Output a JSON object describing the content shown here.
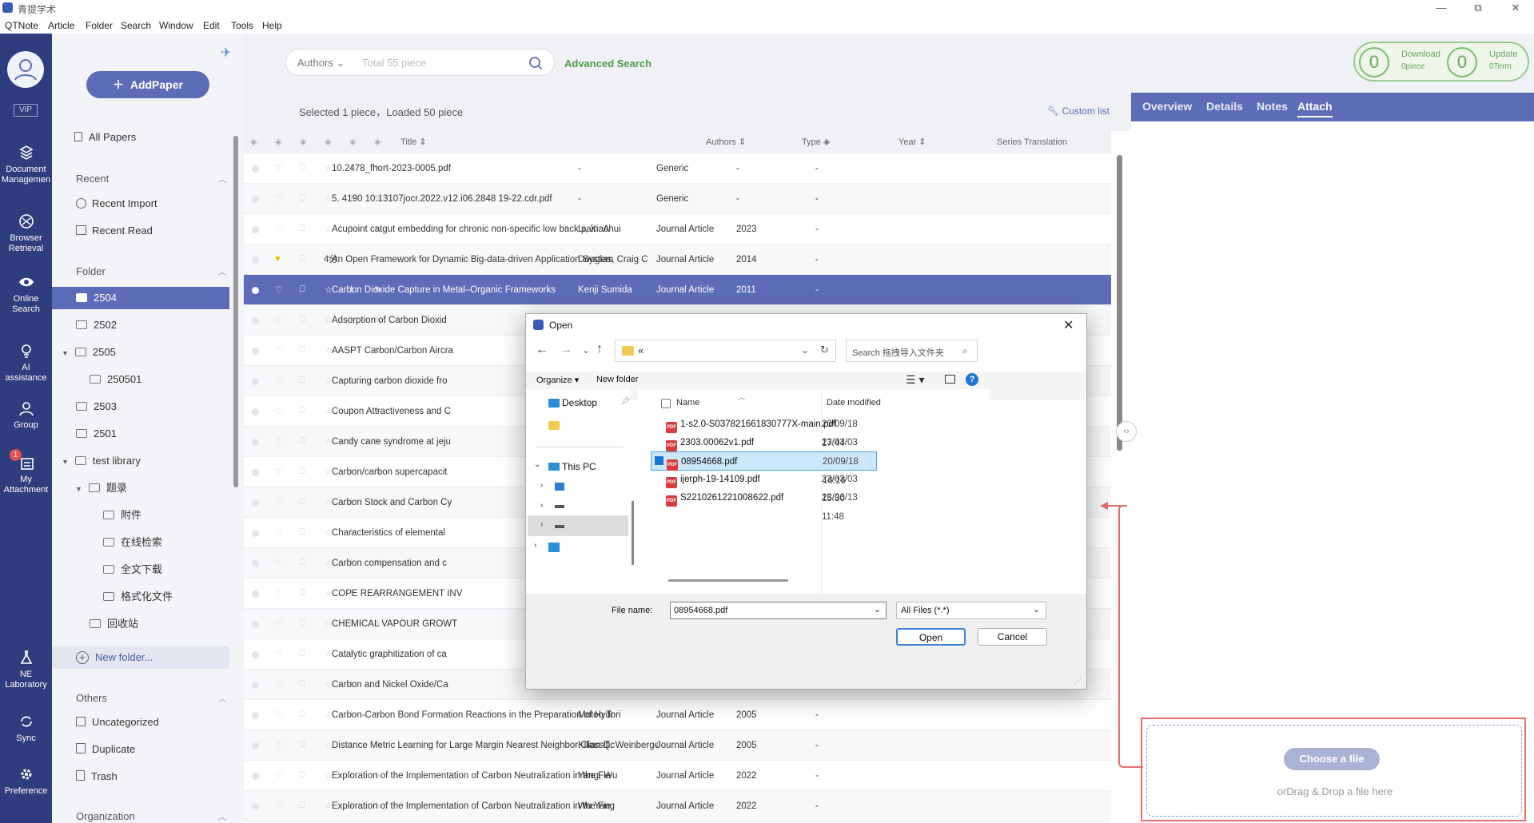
{
  "app": {
    "title": "青提学术"
  },
  "menu": [
    "QTNote",
    "Article",
    "Folder",
    "Search",
    "Window",
    "Edit",
    "Tools",
    "Help"
  ],
  "window_controls": [
    "—",
    "▢",
    "⧉",
    "✕"
  ],
  "leftnav": {
    "vip": "VIP",
    "items": [
      {
        "label": "Document Managemen",
        "icon": "document-icon"
      },
      {
        "label": "Browser Retrieval",
        "icon": "browser-icon"
      },
      {
        "label": "Online Search",
        "icon": "eye-icon"
      },
      {
        "label": "AI assistance",
        "icon": "ai-icon"
      },
      {
        "label": "Group",
        "icon": "group-icon"
      },
      {
        "label": "My Attachment",
        "icon": "attachment-icon",
        "badge": "1"
      },
      {
        "label": "NE Laboratory",
        "icon": "laboratory-icon"
      },
      {
        "label": "Sync",
        "icon": "sync-icon"
      },
      {
        "label": "Preference",
        "icon": "gear-icon"
      }
    ]
  },
  "folderpanel": {
    "add_paper": "AddPaper",
    "all_papers": "All Papers",
    "recent_title": "Recent",
    "recent_import": "Recent Import",
    "recent_read": "Recent Read",
    "folder_title": "Folder",
    "folders": [
      "2504",
      "2502",
      "2505",
      "250501",
      "2503",
      "2501",
      "test library",
      "题录",
      "附件",
      "在线检索",
      "全文下载",
      "格式化文件",
      "回收站"
    ],
    "new_folder": "New folder...",
    "others_title": "Others",
    "uncategorized": "Uncategorized",
    "duplicate": "Duplicate",
    "trash": "Trash",
    "organization_title": "Organization"
  },
  "search": {
    "field": "Authors",
    "placeholder": "Total 55 piece",
    "advanced": "Advanced Search"
  },
  "stats": {
    "download_count": "0",
    "download_label": "Download",
    "download_sub": "0piece",
    "update_count": "0",
    "update_label": "Update",
    "update_sub": "0Term"
  },
  "list": {
    "status": "Selected 1 piece，Loaded 50 piece",
    "custom_list": "Custom list",
    "columns": {
      "title": "Title",
      "authors": "Authors",
      "type": "Type",
      "year": "Year",
      "series": "Series Translation"
    },
    "rows": [
      {
        "title": "10.2478_fhort-2023-0005.pdf",
        "authors": "-",
        "type": "Generic",
        "year": "-",
        "series": "-"
      },
      {
        "title": "5. 4190 10.13107jocr.2022.v12.i06.2848 19-22.cdr.pdf",
        "authors": "-",
        "type": "Generic",
        "year": "-",
        "series": "-"
      },
      {
        "title": "Acupoint catgut embedding for chronic non-specific low back pain: A",
        "authors": "Li, Xiaohui",
        "type": "Journal Article",
        "year": "2023",
        "series": "-"
      },
      {
        "title": "An Open Framework for Dynamic Big-data-driven Application System",
        "authors": "Douglas, Craig C",
        "type": "Journal Article",
        "year": "2014",
        "series": "-",
        "rating": "4分"
      },
      {
        "title": "Carbon Dioxide Capture in Metal–Organic Frameworks",
        "authors": "Kenji Sumida",
        "type": "Journal Article",
        "year": "2011",
        "series": "-"
      },
      {
        "title": "Adsorption of Carbon Dioxid",
        "authors": "",
        "type": "",
        "year": "",
        "series": ""
      },
      {
        "title": "AASPT Carbon/Carbon Aircra",
        "authors": "",
        "type": "",
        "year": "",
        "series": ""
      },
      {
        "title": "Capturing carbon dioxide fro",
        "authors": "",
        "type": "",
        "year": "",
        "series": ""
      },
      {
        "title": "Coupon Attractiveness and C",
        "authors": "",
        "type": "",
        "year": "",
        "series": ""
      },
      {
        "title": "Candy cane syndrome at jeju",
        "authors": "",
        "type": "",
        "year": "",
        "series": ""
      },
      {
        "title": "Carbon/carbon supercapacit",
        "authors": "",
        "type": "",
        "year": "",
        "series": ""
      },
      {
        "title": "Carbon Stock and Carbon Cy",
        "authors": "",
        "type": "",
        "year": "",
        "series": ""
      },
      {
        "title": "Characteristics of elemental",
        "authors": "",
        "type": "",
        "year": "",
        "series": ""
      },
      {
        "title": "Carbon compensation and c",
        "authors": "",
        "type": "",
        "year": "",
        "series": ""
      },
      {
        "title": "COPE REARRANGEMENT INV",
        "authors": "",
        "type": "",
        "year": "",
        "series": ""
      },
      {
        "title": "CHEMICAL VAPOUR GROWT",
        "authors": "",
        "type": "",
        "year": "",
        "series": ""
      },
      {
        "title": "Catalytic graphitization of ca",
        "authors": "",
        "type": "",
        "year": "",
        "series": ""
      },
      {
        "title": "Carbon and Nickel Oxide/Ca",
        "authors": "",
        "type": "",
        "year": "",
        "series": ""
      },
      {
        "title": "Carbon-Carbon Bond Formation Reactions in the Preparation of Hydr",
        "authors": "Motoo Tori",
        "type": "Journal Article",
        "year": "2005",
        "series": "-"
      },
      {
        "title": "Distance Metric Learning for Large Margin Nearest Neighbor Classific",
        "authors": "Kilian Q. Weinberger",
        "type": "Journal Article",
        "year": "2005",
        "series": "-"
      },
      {
        "title": "Exploration of the Implementation of Carbon Neutralization in the Fie",
        "authors": "Yang, Wu",
        "type": "Journal Article",
        "year": "2022",
        "series": "-"
      },
      {
        "title": "Exploration of the Implementation of Carbon Neutralization in the Fie",
        "authors": "Wu Yang",
        "type": "Journal Article",
        "year": "2022",
        "series": "-"
      }
    ]
  },
  "rightpanel": {
    "tabs": [
      "Overview",
      "Details",
      "Notes",
      "Attach"
    ],
    "choose_file": "Choose a file",
    "drop_hint": "orDrag & Drop a file here"
  },
  "dialog": {
    "title": "Open",
    "path": "«",
    "search_placeholder": "Search 拖拽导入文件夹",
    "organize": "Organize",
    "new_folder": "New folder",
    "nav": {
      "desktop": "Desktop",
      "this_pc": "This PC"
    },
    "col_name": "Name",
    "col_date": "Date modified",
    "files": [
      {
        "name": "1-s2.0-S037821661830777X-main.pdf",
        "date": "20/09/18 17:44"
      },
      {
        "name": "2303.00062v1.pdf",
        "date": "23/03/03 11:24"
      },
      {
        "name": "08954668.pdf",
        "date": "20/09/18 16:16"
      },
      {
        "name": "ijerph-19-14109.pdf",
        "date": "23/03/03 15:30"
      },
      {
        "name": "S2210261221008622.pdf",
        "date": "23/06/13 11:48"
      }
    ],
    "file_name_label": "File name:",
    "file_name_value": "08954668.pdf",
    "file_type": "All Files (*.*)",
    "open_btn": "Open",
    "cancel_btn": "Cancel"
  },
  "colors": {
    "nav_bg": "#2e3d7d",
    "accent": "#5d6cb8",
    "highlight_red": "#e96c6c",
    "advanced_search": "#4f9a48"
  }
}
